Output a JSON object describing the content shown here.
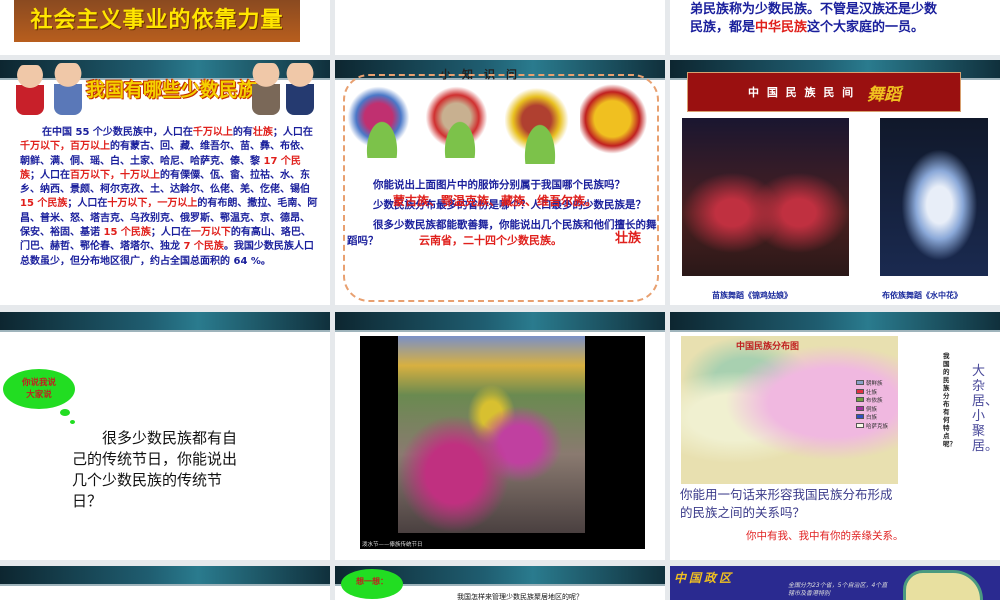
{
  "slides": [
    {
      "banner": "社会主义事业的依靠力量"
    },
    {},
    {
      "line1": "弟民族称为少数民族。不管是汉族还是少数",
      "line2a": "民族，都是",
      "line2b": "中华民族",
      "line2c": "这个大家庭的一员。"
    },
    {
      "title": "我国有哪些少数民族?",
      "p": [
        [
          "b",
          "在中国 55 个少数民族中，人口在"
        ],
        [
          "r",
          "千万以上"
        ],
        [
          "b",
          "的有"
        ],
        [
          "r",
          "壮族"
        ],
        [
          "b",
          "；人口在"
        ],
        [
          "r",
          "千万以下，百万以上"
        ],
        [
          "b",
          "的有蒙古、回、藏、维吾尔、苗、彝、布依、朝鲜、满、侗、瑶、白、土家、哈尼、哈萨克、傣、黎 "
        ],
        [
          "r",
          "17 个民族"
        ],
        [
          "b",
          "；人口在"
        ],
        [
          "r",
          "百万以下，十万以上"
        ],
        [
          "b",
          "的有傈僳、佤、畲、拉祜、水、东乡、纳西、景颇、柯尔克孜、土、达斡尔、仫佬、羌、仡佬、锡伯 "
        ],
        [
          "r",
          "15 个民族"
        ],
        [
          "b",
          "；人口在"
        ],
        [
          "r",
          "十万以下，一万以上"
        ],
        [
          "b",
          "的有布朗、撒拉、毛南、阿昌、普米、怒、塔吉克、乌孜别克、俄罗斯、鄂温克、京、德昂、保安、裕固、基诺 "
        ],
        [
          "r",
          "15 个民族"
        ],
        [
          "b",
          "；人口在"
        ],
        [
          "r",
          "一万以下"
        ],
        [
          "b",
          "的有高山、珞巴、门巴、赫哲、鄂伦春、塔塔尔、独龙 "
        ],
        [
          "r",
          "7 个民族"
        ],
        [
          "b",
          "。我国少数民族人口总数虽少，但分布地区很广，约占全国总面积的 64 %。"
        ]
      ]
    },
    {
      "title": "小　知　识　问",
      "q1": "你能说出上面图片中的服饰分别属于我国哪个民族吗？",
      "a1": "蒙古族、鄂温克族、藏族、维吾尔族。",
      "q2": "少数民族分布最多的省份是哪个？人口最多的少数民族是？",
      "a2": "云南省，二十四个少数民族。",
      "a3": "壮族",
      "q3": "很多少数民族都能歌善舞，你能说出几个民族和他们擅长的舞蹈吗？"
    },
    {
      "banner": "中 国 民 族 民 间",
      "banner_art": "舞蹈",
      "cap1": "苗族舞蹈《锦鸡姑娘》",
      "cap2": "布依族舞蹈《水中花》"
    },
    {
      "bubble": "你说我说大家说",
      "text": "很多少数民族都有自己的传统节日，你能说出几个少数民族的传统节日？"
    },
    {
      "caption": "泼水节——傣族传统节日"
    },
    {
      "map_title": "中国民族分布图",
      "legend": [
        "朝鲜族",
        "壮族",
        "布依族",
        "侗族",
        "白族",
        "哈萨克族"
      ],
      "vertical_q": "我国的民族分布有何特点呢？",
      "answer": "大杂居、小聚居。",
      "q": "你能用一句话来形容我国民族分布形成的民族之间的关系吗？",
      "a": "你中有我、我中有你的亲缘关系。"
    },
    {},
    {
      "bubble": "想一想：",
      "q": "我国怎样来管理少数民族聚居地区的呢？"
    },
    {
      "title": "中国政区",
      "text": "全国分为23个省，5个自治区，4个直辖市及香港特别"
    }
  ]
}
